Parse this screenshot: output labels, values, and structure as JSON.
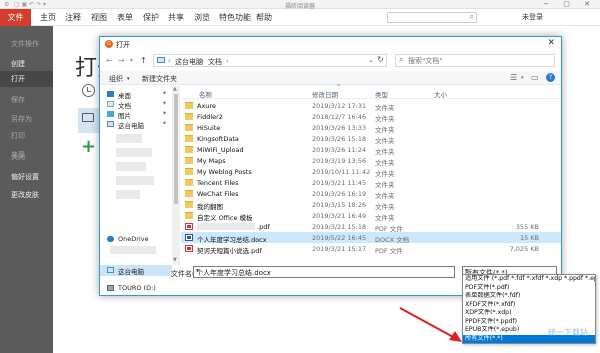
{
  "app": {
    "title": "福昕阅读器",
    "login_label": "未登录",
    "menu": [
      "文件",
      "主页",
      "注释",
      "视图",
      "表单",
      "保护",
      "共享",
      "浏览",
      "特色功能",
      "帮助"
    ],
    "sidebar": [
      "文件操作",
      "创建",
      "打开",
      "保存",
      "另存为",
      "打印",
      "共享",
      "关闭",
      "偏好设置",
      "更改皮肤"
    ],
    "main_heading": "打开"
  },
  "dialog": {
    "title": "打开",
    "breadcrumb": [
      "这台电脑",
      "文档"
    ],
    "search_placeholder": "搜索\"文档\"",
    "toolbar": {
      "organize": "组织",
      "new_folder": "新建文件夹"
    },
    "nav": [
      {
        "label": "桌面",
        "icon": "desktop-icon"
      },
      {
        "label": "文档",
        "icon": "documents-icon"
      },
      {
        "label": "图片",
        "icon": "pictures-icon"
      },
      {
        "label": "这台电脑",
        "icon": "computer-icon"
      },
      {
        "label": "OneDrive",
        "icon": "cloud-icon"
      },
      {
        "label": "这台电脑",
        "icon": "computer-icon"
      },
      {
        "label": "TOURO (D:)",
        "icon": "drive-icon"
      }
    ],
    "columns": {
      "name": "名称",
      "date": "修改日期",
      "type": "类型",
      "size": "大小"
    },
    "files": [
      {
        "name": "Axure",
        "date": "2019/3/12 17:31",
        "type": "文件夹",
        "size": "",
        "kind": "folder"
      },
      {
        "name": "Fiddler2",
        "date": "2018/12/7 16:46",
        "type": "文件夹",
        "size": "",
        "kind": "folder"
      },
      {
        "name": "HiSuite",
        "date": "2019/3/26 13:33",
        "type": "文件夹",
        "size": "",
        "kind": "folder"
      },
      {
        "name": "KingsoftData",
        "date": "2019/3/26 15:18",
        "type": "文件夹",
        "size": "",
        "kind": "folder"
      },
      {
        "name": "MiWiFi_Upload",
        "date": "2019/3/26 11:24",
        "type": "文件夹",
        "size": "",
        "kind": "folder"
      },
      {
        "name": "My Maps",
        "date": "2019/3/19 13:56",
        "type": "文件夹",
        "size": "",
        "kind": "folder"
      },
      {
        "name": "My Weblog Posts",
        "date": "2019/10/11 11:42",
        "type": "文件夹",
        "size": "",
        "kind": "folder"
      },
      {
        "name": "Tencent Files",
        "date": "2019/3/21 11:45",
        "type": "文件夹",
        "size": "",
        "kind": "folder"
      },
      {
        "name": "WeChat Files",
        "date": "2019/3/26 16:19",
        "type": "文件夹",
        "size": "",
        "kind": "folder"
      },
      {
        "name": "我的翻图",
        "date": "2019/3/15 18:26",
        "type": "文件夹",
        "size": "",
        "kind": "folder"
      },
      {
        "name": "自定义 Office 模板",
        "date": "2019/3/21 16:49",
        "type": "文件夹",
        "size": "",
        "kind": "folder"
      },
      {
        "name": ".pdf",
        "date": "2019/3/21 15:18",
        "type": "PDF 文件",
        "size": "355 KB",
        "kind": "pdf"
      },
      {
        "name": "个人年度学习总结.docx",
        "date": "2019/5/22 16:45",
        "type": "DOCX 文档",
        "size": "15 KB",
        "kind": "doc",
        "selected": true
      },
      {
        "name": "契诃夫短篇小说选.pdf",
        "date": "2019/3/21 15:17",
        "type": "PDF 文件",
        "size": "7,025 KB",
        "kind": "pdf"
      }
    ],
    "filename_label": "文件名(N):",
    "filename_value": "个人年度学习总结.docx",
    "filetype_selected": "所有文件(*.*)",
    "filetype_options": [
      "适用文件 (*.pdf *.fdf *.xfdf *.xdp *.ppdf *.epub)",
      "PDF文件(*.pdf)",
      "表单数据文件(*.fdf)",
      "XFDF文件(*.xfdf)",
      "XDP文件(*.xdp)",
      "PPDF文件(*.ppdf)",
      "EPUB文件(*.epub)",
      "所有文件(*.*)"
    ],
    "highlight_option_index": 7
  },
  "watermark": "统一下载站",
  "colors": {
    "accent_red": "#d53c2c",
    "dialog_border": "#2aa0d0",
    "selection": "#cce8ff",
    "option_highlight": "#0078d7",
    "arrow": "#e02020"
  }
}
